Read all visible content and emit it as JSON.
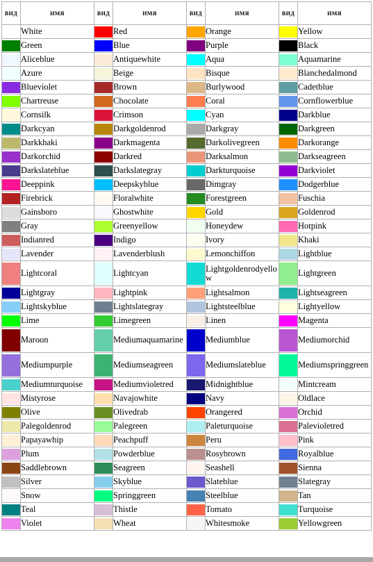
{
  "table": {
    "headers": {
      "view": "ВИД",
      "name": "ИМЯ"
    },
    "column_pairs": 4,
    "rows": [
      [
        {
          "name": "White",
          "color": "#ffffff"
        },
        {
          "name": "Red",
          "color": "#ff0000"
        },
        {
          "name": "Orange",
          "color": "#ffa500"
        },
        {
          "name": "Yellow",
          "color": "#ffff00"
        }
      ],
      [
        {
          "name": "Green",
          "color": "#008000"
        },
        {
          "name": "Blue",
          "color": "#0000ff"
        },
        {
          "name": "Purple",
          "color": "#800080"
        },
        {
          "name": "Black",
          "color": "#000000"
        }
      ],
      [
        {
          "name": "Aliceblue",
          "color": "#f0f8ff"
        },
        {
          "name": "Antiquewhite",
          "color": "#faebd7"
        },
        {
          "name": "Aqua",
          "color": "#00ffff"
        },
        {
          "name": "Aquamarine",
          "color": "#7fffd4"
        }
      ],
      [
        {
          "name": "Azure",
          "color": "#f0ffff"
        },
        {
          "name": "Beige",
          "color": "#f5f5dc"
        },
        {
          "name": "Bisque",
          "color": "#ffe4c4"
        },
        {
          "name": "Blanchedalmond",
          "color": "#ffebcd"
        }
      ],
      [
        {
          "name": "Blueviolet",
          "color": "#8a2be2"
        },
        {
          "name": "Brown",
          "color": "#a52a2a"
        },
        {
          "name": "Burlywood",
          "color": "#deb887"
        },
        {
          "name": "Cadetblue",
          "color": "#5f9ea0"
        }
      ],
      [
        {
          "name": "Chartreuse",
          "color": "#7fff00"
        },
        {
          "name": "Chocolate",
          "color": "#d2691e"
        },
        {
          "name": "Coral",
          "color": "#ff7f50"
        },
        {
          "name": "Cornflowerblue",
          "color": "#6495ed"
        }
      ],
      [
        {
          "name": "Cornsilk",
          "color": "#fff8dc"
        },
        {
          "name": "Crimson",
          "color": "#dc143c"
        },
        {
          "name": "Cyan",
          "color": "#00ffff"
        },
        {
          "name": "Darkblue",
          "color": "#00008b"
        }
      ],
      [
        {
          "name": "Darkcyan",
          "color": "#008b8b"
        },
        {
          "name": "Darkgoldenrod",
          "color": "#b8860b"
        },
        {
          "name": "Darkgray",
          "color": "#a9a9a9"
        },
        {
          "name": "Darkgreen",
          "color": "#006400"
        }
      ],
      [
        {
          "name": "Darkkhaki",
          "color": "#bdb76b"
        },
        {
          "name": "Darkmagenta",
          "color": "#8b008b"
        },
        {
          "name": "Darkolivegreen",
          "color": "#556b2f"
        },
        {
          "name": "Darkorange",
          "color": "#ff8c00"
        }
      ],
      [
        {
          "name": "Darkorchid",
          "color": "#9932cc"
        },
        {
          "name": "Darkred",
          "color": "#8b0000"
        },
        {
          "name": "Darksalmon",
          "color": "#e9967a"
        },
        {
          "name": "Darkseagreen",
          "color": "#8fbc8f"
        }
      ],
      [
        {
          "name": "Darkslateblue",
          "color": "#483d8b"
        },
        {
          "name": "Darkslategray",
          "color": "#2f4f4f"
        },
        {
          "name": "Darkturquoise",
          "color": "#00ced1"
        },
        {
          "name": "Darkviolet",
          "color": "#9400d3"
        }
      ],
      [
        {
          "name": "Deeppink",
          "color": "#ff1493"
        },
        {
          "name": "Deepskyblue",
          "color": "#00bfff"
        },
        {
          "name": "Dimgray",
          "color": "#696969"
        },
        {
          "name": "Dodgerblue",
          "color": "#1e90ff"
        }
      ],
      [
        {
          "name": "Firebrick",
          "color": "#b22222"
        },
        {
          "name": "Floralwhite",
          "color": "#fffaf0"
        },
        {
          "name": "Forestgreen",
          "color": "#228b22"
        },
        {
          "name": "Fuschia",
          "color": "#f2c1a0"
        }
      ],
      [
        {
          "name": "Gainsboro",
          "color": "#dcdcdc"
        },
        {
          "name": "Ghostwhite",
          "color": "#f8f8ff"
        },
        {
          "name": "Gold",
          "color": "#ffd700"
        },
        {
          "name": "Goldenrod",
          "color": "#daa520"
        }
      ],
      [
        {
          "name": "Gray",
          "color": "#808080"
        },
        {
          "name": "Greenyellow",
          "color": "#adff2f"
        },
        {
          "name": "Honeydew",
          "color": "#f0fff0"
        },
        {
          "name": "Hotpink",
          "color": "#ff69b4"
        }
      ],
      [
        {
          "name": "Indianred",
          "color": "#cd5c5c"
        },
        {
          "name": "Indigo",
          "color": "#4b0082"
        },
        {
          "name": "Ivory",
          "color": "#fffff0"
        },
        {
          "name": "Khaki",
          "color": "#f0e68c"
        }
      ],
      [
        {
          "name": "Lavender",
          "color": "#e6e6fa"
        },
        {
          "name": "Lavenderblush",
          "color": "#fff0f5"
        },
        {
          "name": "Lemonchiffon",
          "color": "#fffacd"
        },
        {
          "name": "Lightblue",
          "color": "#add8e6"
        }
      ],
      [
        {
          "name": "Lightcoral",
          "color": "#f08080"
        },
        {
          "name": "Lightcyan",
          "color": "#e0ffff"
        },
        {
          "name": "Lightgoldenrodyellow",
          "color": "#12dbd4"
        },
        {
          "name": "Lightgreen",
          "color": "#90ee90"
        }
      ],
      [
        {
          "name": "Lightgray",
          "color": "#000099"
        },
        {
          "name": "Lightpink",
          "color": "#ffb6c1"
        },
        {
          "name": "Lightsalmon",
          "color": "#ffa07a"
        },
        {
          "name": "Lightseagreen",
          "color": "#20b2aa"
        }
      ],
      [
        {
          "name": "Lightskyblue",
          "color": "#87cefa"
        },
        {
          "name": "Lightslategray",
          "color": "#708090"
        },
        {
          "name": "Lightsteelblue",
          "color": "#b0c4de"
        },
        {
          "name": "Lightyellow",
          "color": "#ffffe0"
        }
      ],
      [
        {
          "name": "Lime",
          "color": "#00ff00"
        },
        {
          "name": "Limegreen",
          "color": "#32cd32"
        },
        {
          "name": "Linen",
          "color": "#faf0e6"
        },
        {
          "name": "Magenta",
          "color": "#ff00ff"
        }
      ],
      [
        {
          "name": "Maroon",
          "color": "#800000"
        },
        {
          "name": "Mediumaquamarine",
          "color": "#66cdaa"
        },
        {
          "name": "Mediumblue",
          "color": "#0000cd"
        },
        {
          "name": "Mediumorchid",
          "color": "#ba55d3"
        }
      ],
      [
        {
          "name": "Mediumpurple",
          "color": "#9370db"
        },
        {
          "name": "Mediumseagreen",
          "color": "#3cb371"
        },
        {
          "name": "Mediumslateblue",
          "color": "#7b68ee"
        },
        {
          "name": "Mediumspringgreen",
          "color": "#00fa9a"
        }
      ],
      [
        {
          "name": "Mediumturquoise",
          "color": "#48d1cc"
        },
        {
          "name": "Mediumvioletred",
          "color": "#c71585"
        },
        {
          "name": "Midnightblue",
          "color": "#191970"
        },
        {
          "name": "Mintcream",
          "color": "#f5fffa"
        }
      ],
      [
        {
          "name": "Mistyrose",
          "color": "#ffe4e1"
        },
        {
          "name": "Navajowhite",
          "color": "#ffdead"
        },
        {
          "name": "Navy",
          "color": "#000080"
        },
        {
          "name": "Oldlace",
          "color": "#fdf5e6"
        }
      ],
      [
        {
          "name": "Olive",
          "color": "#808000"
        },
        {
          "name": "Olivedrab",
          "color": "#6b8e23"
        },
        {
          "name": "Orangered",
          "color": "#ff4500"
        },
        {
          "name": "Orchid",
          "color": "#da70d6"
        }
      ],
      [
        {
          "name": "Palegoldenrod",
          "color": "#eee8aa"
        },
        {
          "name": "Palegreen",
          "color": "#98fb98"
        },
        {
          "name": "Paleturquoise",
          "color": "#afeeee"
        },
        {
          "name": "Palevioletred",
          "color": "#db7093"
        }
      ],
      [
        {
          "name": "Papayawhip",
          "color": "#ffefd5"
        },
        {
          "name": "Peachpuff",
          "color": "#ffdab9"
        },
        {
          "name": "Peru",
          "color": "#cd853f"
        },
        {
          "name": "Pink",
          "color": "#ffc0cb"
        }
      ],
      [
        {
          "name": "Plum",
          "color": "#dda0dd"
        },
        {
          "name": "Powderblue",
          "color": "#b0e0e6"
        },
        {
          "name": "Rosybrown",
          "color": "#bc8f8f"
        },
        {
          "name": "Royalblue",
          "color": "#4169e1"
        }
      ],
      [
        {
          "name": "Saddlebrown",
          "color": "#8b4513"
        },
        {
          "name": "Seagreen",
          "color": "#2e8b57"
        },
        {
          "name": "Seashell",
          "color": "#fff5ee"
        },
        {
          "name": "Sienna",
          "color": "#a0522d"
        }
      ],
      [
        {
          "name": "Silver",
          "color": "#c0c0c0"
        },
        {
          "name": "Skyblue",
          "color": "#87ceeb"
        },
        {
          "name": "Slateblue",
          "color": "#6a5acd"
        },
        {
          "name": "Slategray",
          "color": "#708090"
        }
      ],
      [
        {
          "name": "Snow",
          "color": "#fffafa"
        },
        {
          "name": "Springgreen",
          "color": "#00ff7f"
        },
        {
          "name": "Steelblue",
          "color": "#4682b4"
        },
        {
          "name": "Tan",
          "color": "#d2b48c"
        }
      ],
      [
        {
          "name": "Teal",
          "color": "#008080"
        },
        {
          "name": "Thistle",
          "color": "#d8bfd8"
        },
        {
          "name": "Tomato",
          "color": "#ff6347"
        },
        {
          "name": "Turquoise",
          "color": "#40e0d0"
        }
      ],
      [
        {
          "name": "Violet",
          "color": "#ee82ee"
        },
        {
          "name": "Wheat",
          "color": "#f5deb3"
        },
        {
          "name": "Whitesmoke",
          "color": "#f5f5f5"
        },
        {
          "name": "Yellowgreen",
          "color": "#9acd32"
        }
      ]
    ]
  }
}
